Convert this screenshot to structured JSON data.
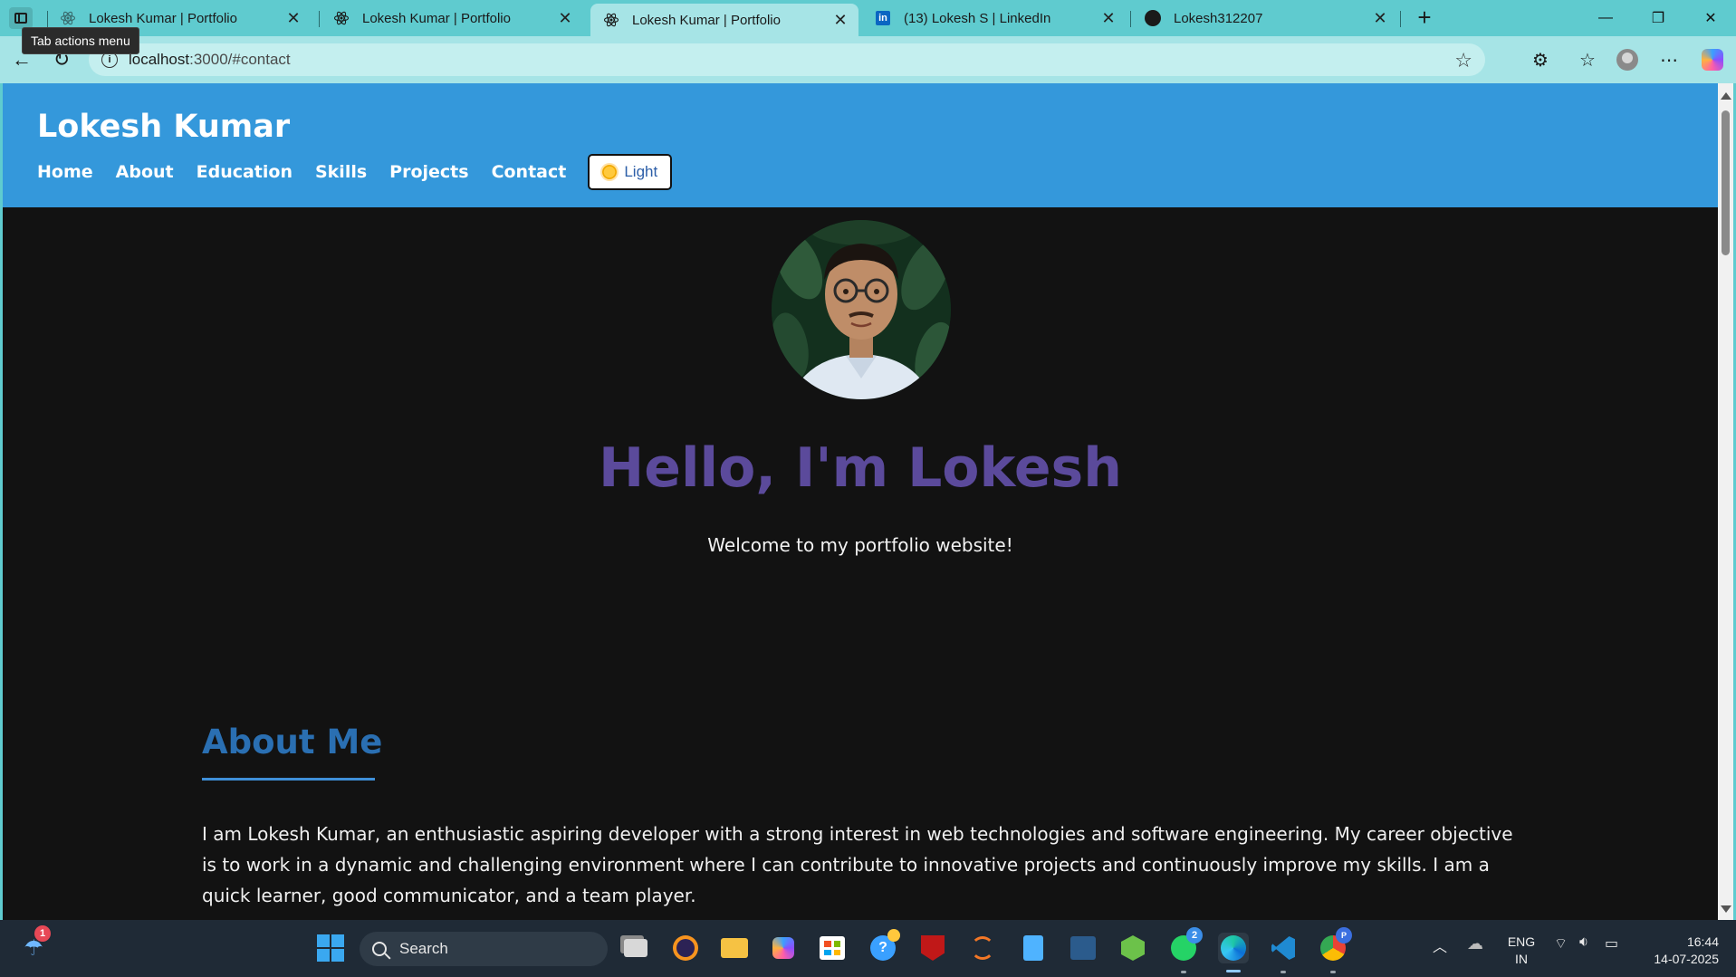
{
  "browser": {
    "tooltip": "Tab actions menu",
    "tabs": [
      {
        "title": "Lokesh Kumar | Portfolio",
        "icon": "react-icon-faded"
      },
      {
        "title": "Lokesh Kumar | Portfolio",
        "icon": "react-icon"
      },
      {
        "title": "Lokesh Kumar | Portfolio",
        "icon": "react-icon",
        "active": true
      },
      {
        "title": "(13) Lokesh S | LinkedIn",
        "icon": "linkedin-icon"
      },
      {
        "title": "Lokesh312207",
        "icon": "github-icon"
      }
    ],
    "address": {
      "host": "localhost",
      "path": ":3000/#contact"
    }
  },
  "site": {
    "brand": "Lokesh Kumar",
    "nav": [
      "Home",
      "About",
      "Education",
      "Skills",
      "Projects",
      "Contact"
    ],
    "theme_toggle": "Light",
    "hero": {
      "title": "Hello, I'm Lokesh",
      "subtitle": "Welcome to my portfolio website!"
    },
    "about": {
      "title": "About Me",
      "text": "I am Lokesh Kumar, an enthusiastic aspiring developer with a strong interest in web technologies and software engineering. My career objective is to work in a dynamic and challenging environment where I can contribute to innovative projects and continuously improve my skills. I am a quick learner, good communicator, and a team player."
    },
    "colors": {
      "header": "#3498db",
      "hero_title": "#5b4a9b",
      "about_title": "#2a6fb2",
      "background": "#121212"
    }
  },
  "taskbar": {
    "search_placeholder": "Search",
    "weather_badge": "1",
    "whatsapp_badge": "2",
    "chrome_badge": "P",
    "language": {
      "line1": "ENG",
      "line2": "IN"
    },
    "time": "16:44",
    "date": "14-07-2025"
  }
}
